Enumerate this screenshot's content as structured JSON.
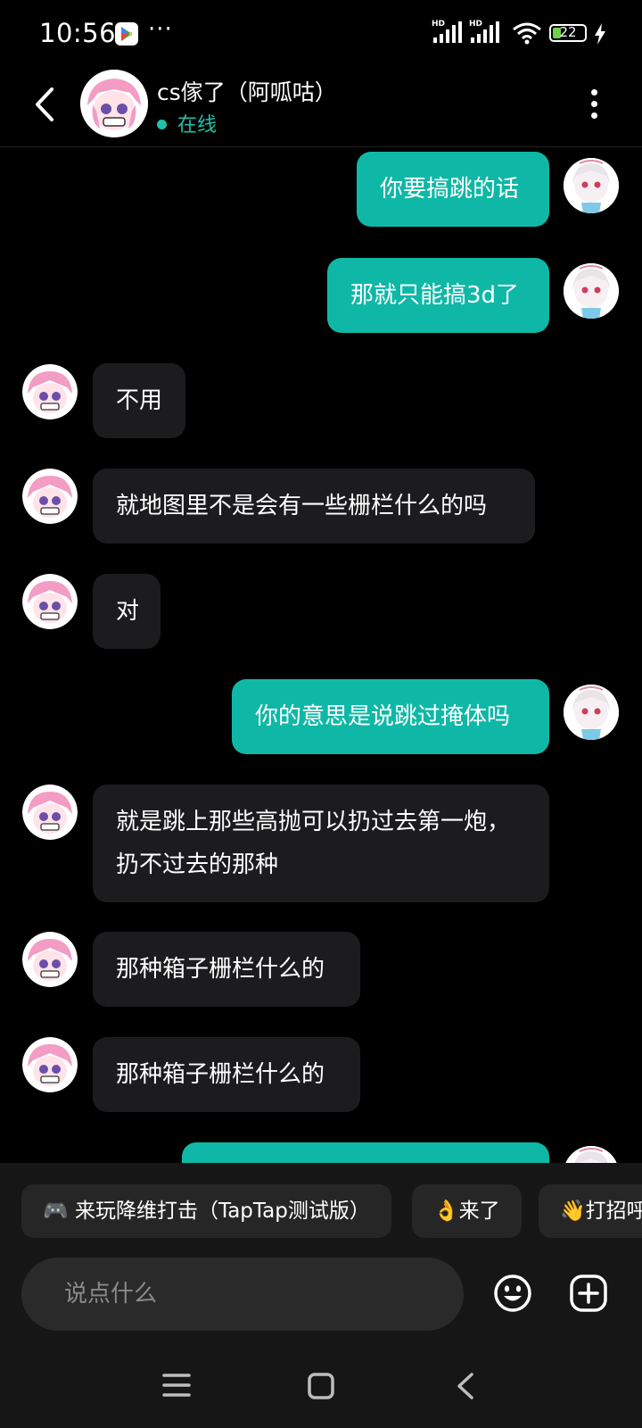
{
  "status_bar": {
    "time": "10:56",
    "more_indicator": "···",
    "network_1": "HD",
    "network_2": "HD",
    "battery_level": "22"
  },
  "header": {
    "contact_name": "cs傢了（阿呱咕）",
    "status": "在线",
    "status_color": "#1fc2a9"
  },
  "messages": [
    {
      "direction": "out",
      "text": "你要搞跳的话"
    },
    {
      "direction": "out",
      "text": "那就只能搞3d了"
    },
    {
      "direction": "in",
      "text": "不用"
    },
    {
      "direction": "in",
      "text": "就地图里不是会有一些栅栏什么的吗"
    },
    {
      "direction": "in",
      "text": "对"
    },
    {
      "direction": "out",
      "text": "你的意思是说跳过掩体吗"
    },
    {
      "direction": "in",
      "text": "就是跳上那些高抛可以扔过去第一炮，扔不过去的那种"
    },
    {
      "direction": "in",
      "text": "那种箱子栅栏什么的"
    },
    {
      "direction": "in",
      "text": "那种箱子栅栏什么的"
    },
    {
      "direction": "out",
      "text": ""
    }
  ],
  "quick_replies": [
    {
      "icon": "🎮",
      "text": "来玩降维打击（TapTap测试版）"
    },
    {
      "icon": "👌",
      "text": "来了"
    },
    {
      "icon": "👋",
      "text": "打招呼"
    }
  ],
  "input": {
    "placeholder": "说点什么"
  },
  "colors": {
    "accent": "#0fb8a6",
    "incoming_bubble": "#1c1c1e",
    "background": "#000000"
  }
}
